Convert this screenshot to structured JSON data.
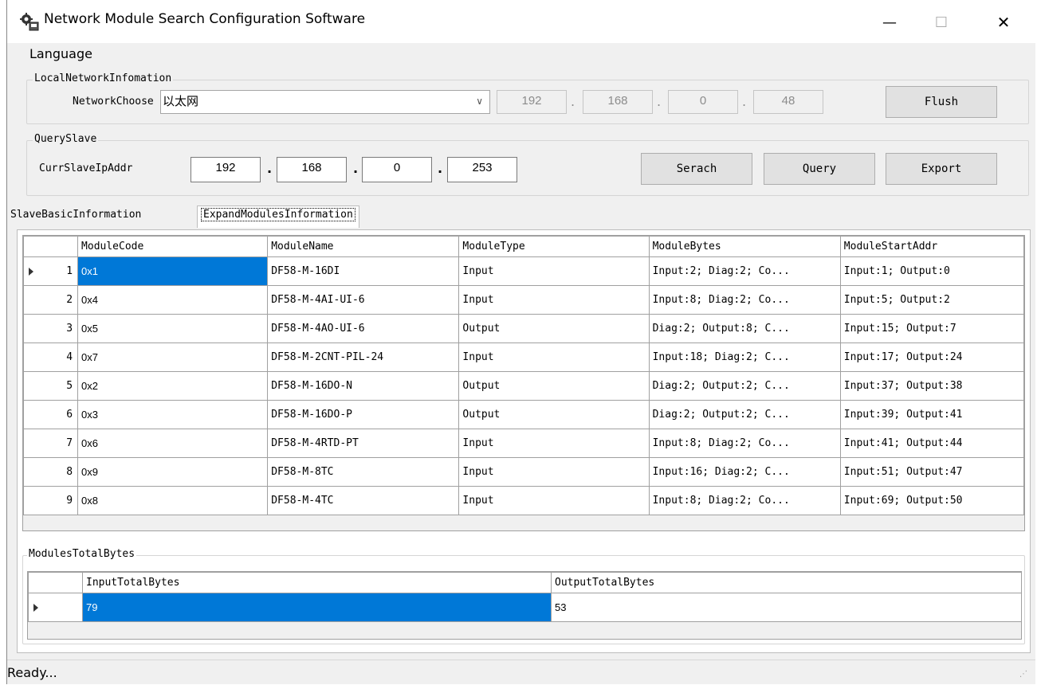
{
  "window": {
    "title": "Network Module Search Configuration Software",
    "minimize_glyph": "—",
    "maximize_glyph": "☐",
    "close_glyph": "✕"
  },
  "menu": {
    "language": "Language"
  },
  "local_network": {
    "legend": "LocalNetworkInfomation",
    "choose_label": "NetworkChoose",
    "choose_value": "以太网",
    "ip": [
      "192",
      "168",
      "0",
      "48"
    ],
    "flush_label": "Flush"
  },
  "query_slave": {
    "legend": "QuerySlave",
    "ip_label": "CurrSlaveIpAddr",
    "ip": [
      "192",
      "168",
      "0",
      "253"
    ],
    "search_label": "Serach",
    "query_label": "Query",
    "export_label": "Export"
  },
  "tabs": [
    "SlaveBasicInformation",
    "ExpandModulesInformation"
  ],
  "modules_table": {
    "columns": [
      "ModuleCode",
      "ModuleName",
      "ModuleType",
      "ModuleBytes",
      "ModuleStartAddr"
    ],
    "rows": [
      {
        "num": "1",
        "code": "0x1",
        "name": "DF58-M-16DI",
        "type": "Input",
        "bytes": "Input:2; Diag:2; Co...",
        "addr": "Input:1; Output:0"
      },
      {
        "num": "2",
        "code": "0x4",
        "name": "DF58-M-4AI-UI-6",
        "type": "Input",
        "bytes": "Input:8; Diag:2; Co...",
        "addr": "Input:5; Output:2"
      },
      {
        "num": "3",
        "code": "0x5",
        "name": "DF58-M-4AO-UI-6",
        "type": "Output",
        "bytes": "Diag:2; Output:8; C...",
        "addr": "Input:15; Output:7"
      },
      {
        "num": "4",
        "code": "0x7",
        "name": "DF58-M-2CNT-PIL-24",
        "type": "Input",
        "bytes": "Input:18; Diag:2; C...",
        "addr": "Input:17; Output:24"
      },
      {
        "num": "5",
        "code": "0x2",
        "name": "DF58-M-16DO-N",
        "type": "Output",
        "bytes": "Diag:2; Output:2; C...",
        "addr": "Input:37; Output:38"
      },
      {
        "num": "6",
        "code": "0x3",
        "name": "DF58-M-16DO-P",
        "type": "Output",
        "bytes": "Diag:2; Output:2; C...",
        "addr": "Input:39; Output:41"
      },
      {
        "num": "7",
        "code": "0x6",
        "name": "DF58-M-4RTD-PT",
        "type": "Input",
        "bytes": "Input:8; Diag:2; Co...",
        "addr": "Input:41; Output:44"
      },
      {
        "num": "8",
        "code": "0x9",
        "name": "DF58-M-8TC",
        "type": "Input",
        "bytes": "Input:16; Diag:2; C...",
        "addr": "Input:51; Output:47"
      },
      {
        "num": "9",
        "code": "0x8",
        "name": "DF58-M-4TC",
        "type": "Input",
        "bytes": "Input:8; Diag:2; Co...",
        "addr": "Input:69; Output:50"
      }
    ]
  },
  "totals": {
    "legend": "ModulesTotalBytes",
    "columns": [
      "InputTotalBytes",
      "OutputTotalBytes"
    ],
    "input": "79",
    "output": "53"
  },
  "status": {
    "text": "Ready..."
  },
  "colors": {
    "selection": "#0078d7",
    "window_bg": "#f0f0f0"
  }
}
